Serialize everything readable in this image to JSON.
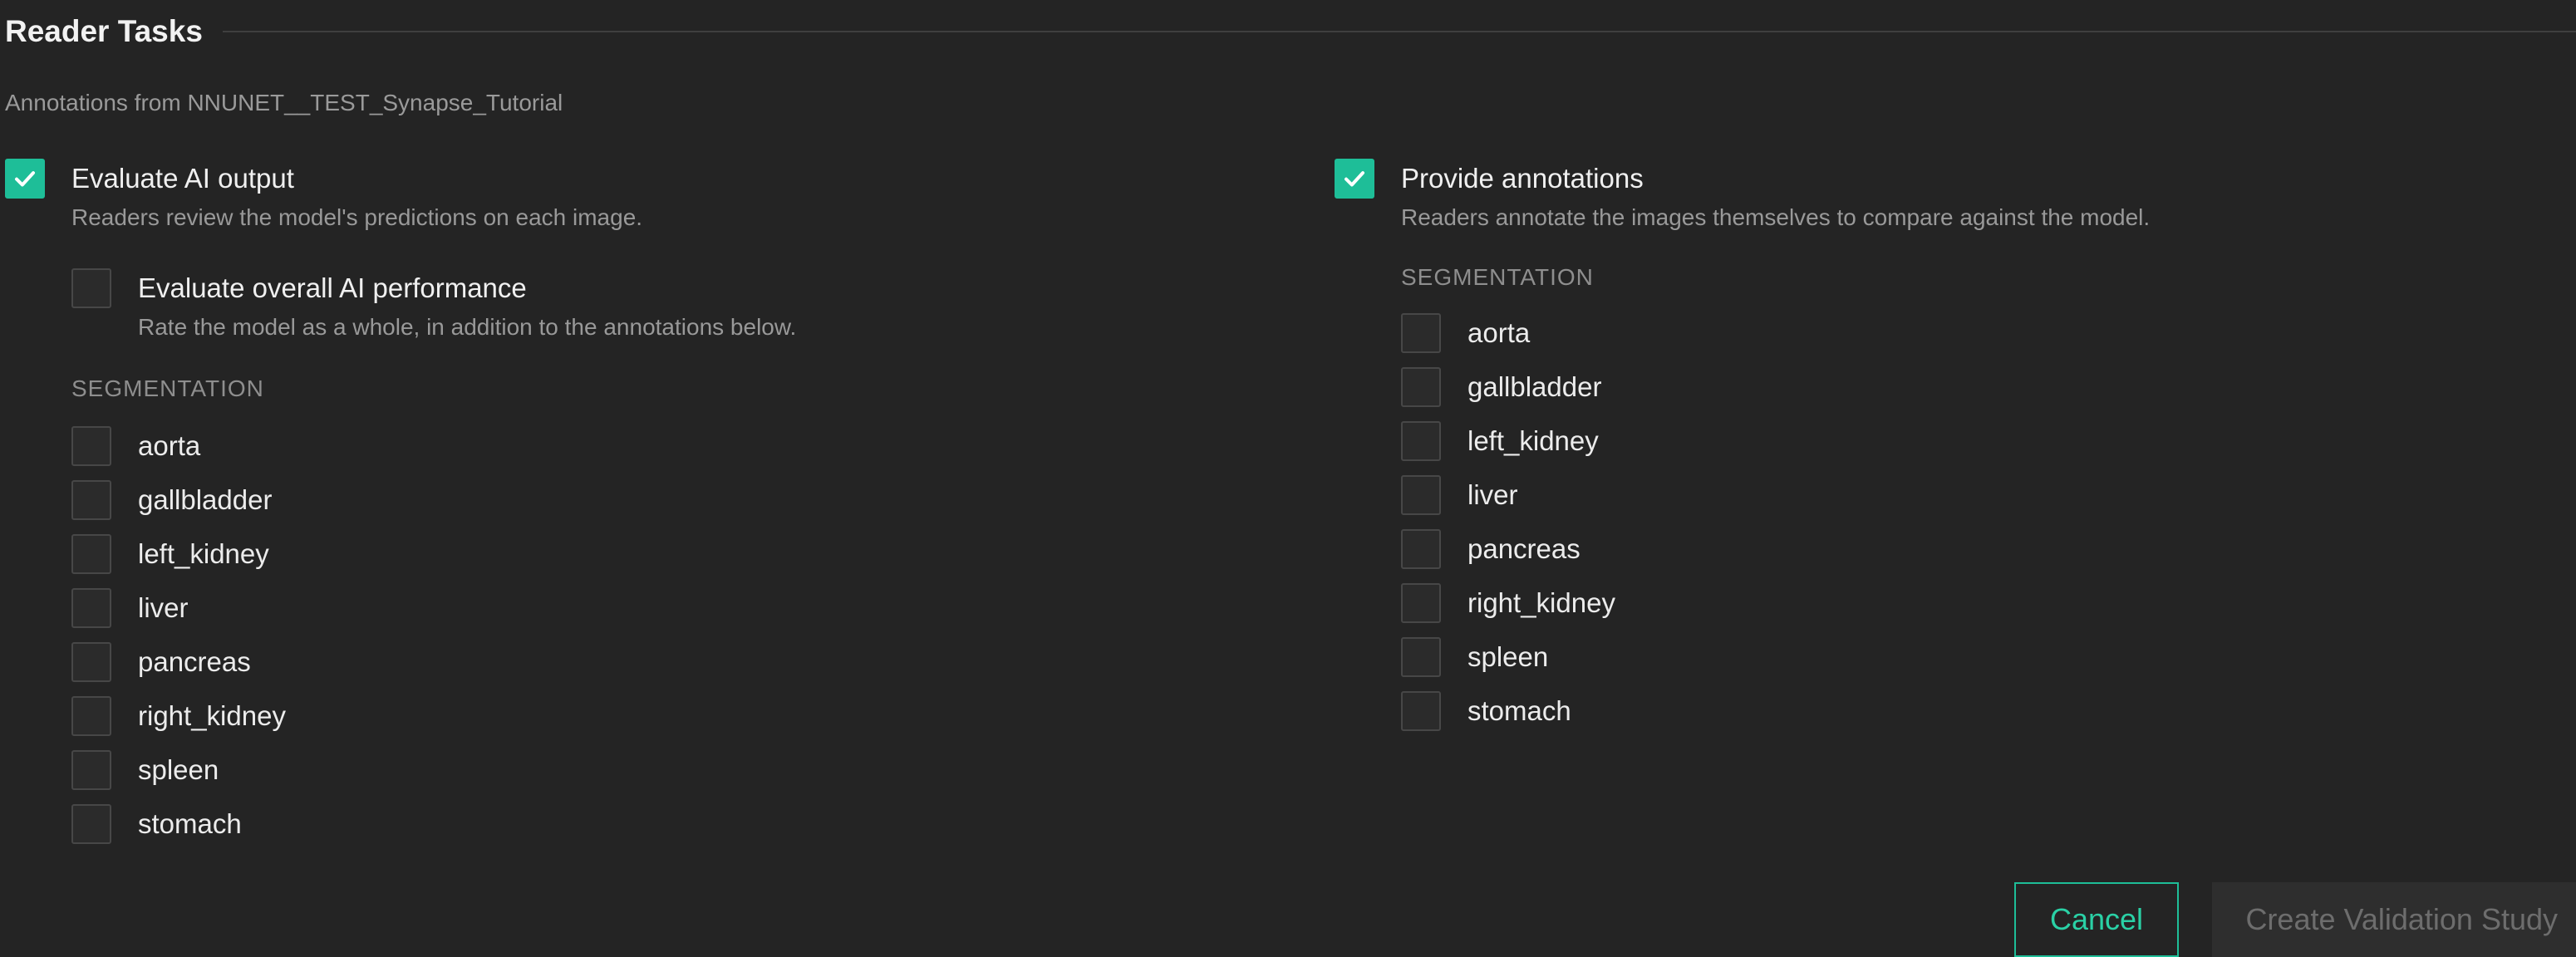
{
  "header": {
    "title": "Reader Tasks",
    "subtitle": "Annotations from NNUNET__TEST_Synapse_Tutorial"
  },
  "evaluate": {
    "label": "Evaluate AI output",
    "checked": true,
    "description": "Readers review the model's predictions on each image.",
    "overall": {
      "label": "Evaluate overall AI performance",
      "checked": false,
      "description": "Rate the model as a whole, in addition to the annotations below."
    },
    "segmentation_heading": "SEGMENTATION",
    "segments": [
      "aorta",
      "gallbladder",
      "left_kidney",
      "liver",
      "pancreas",
      "right_kidney",
      "spleen",
      "stomach"
    ]
  },
  "provide": {
    "label": "Provide annotations",
    "checked": true,
    "description": "Readers annotate the images themselves to compare against the model.",
    "segmentation_heading": "SEGMENTATION",
    "segments": [
      "aorta",
      "gallbladder",
      "left_kidney",
      "liver",
      "pancreas",
      "right_kidney",
      "spleen",
      "stomach"
    ]
  },
  "actions": {
    "cancel_label": "Cancel",
    "create_label": "Create Validation Study",
    "create_enabled": false
  },
  "colors": {
    "accent": "#1ebe98",
    "background": "#242424"
  },
  "icons": {
    "checkbox_checked": "checkmark-icon"
  }
}
